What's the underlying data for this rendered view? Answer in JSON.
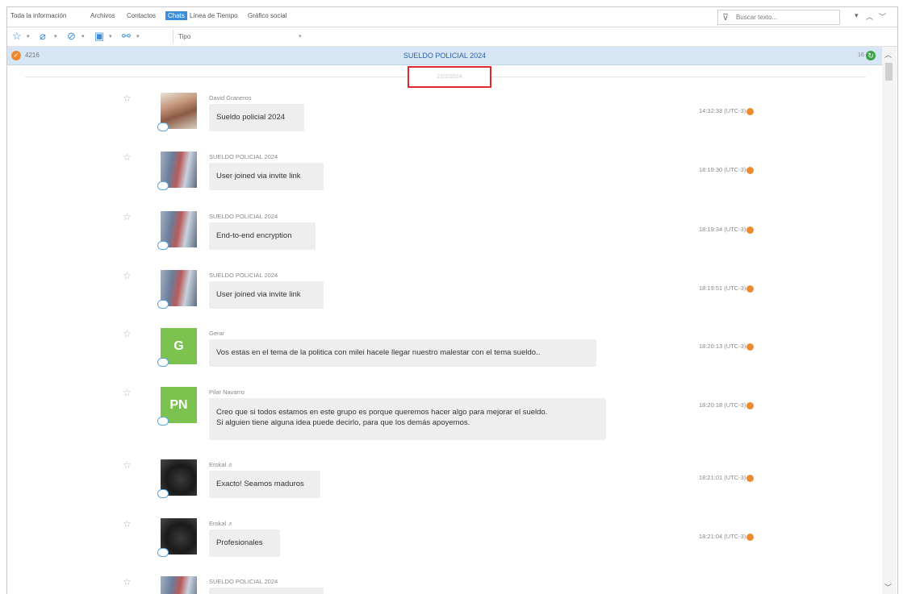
{
  "tabs": [
    {
      "label": "Toda la información",
      "active": false
    },
    {
      "label": "Archivos",
      "active": false
    },
    {
      "label": "Contactos",
      "active": false
    },
    {
      "label": "Chats",
      "active": true
    },
    {
      "label": "Línea de Tiempo",
      "active": false
    },
    {
      "label": "Gráfico social",
      "active": false
    }
  ],
  "search": {
    "placeholder": "Buscar texto..."
  },
  "toolbar": {
    "type_filter": "Tipo"
  },
  "chat_header": {
    "count": "4216",
    "title": "SUELDO POLICIAL 2024",
    "right_count": "16"
  },
  "date_separator": "22/2/2024",
  "messages": [
    {
      "sender": "David Graneros",
      "lines": [
        "Sueldo policial 2024"
      ],
      "time": "14:32:33 (UTC-3)",
      "avatar_type": "photo-a",
      "avatar_initials": ""
    },
    {
      "sender": "SUELDO POLICIAL 2024",
      "lines": [
        "User joined via invite link"
      ],
      "time": "18:19:30 (UTC-3)",
      "avatar_type": "photo-b",
      "avatar_initials": ""
    },
    {
      "sender": "SUELDO POLICIAL 2024",
      "lines": [
        "End-to-end encryption"
      ],
      "time": "18:19:34 (UTC-3)",
      "avatar_type": "photo-b",
      "avatar_initials": ""
    },
    {
      "sender": "SUELDO POLICIAL 2024",
      "lines": [
        "User joined via invite link"
      ],
      "time": "18:19:51 (UTC-3)",
      "avatar_type": "photo-b",
      "avatar_initials": ""
    },
    {
      "sender": "Gerar",
      "lines": [
        "Vos estas en el tema de la politica con milei hacele llegar nuestro malestar con el tema sueldo.."
      ],
      "time": "18:20:13 (UTC-3)",
      "avatar_type": "init",
      "avatar_initials": "G",
      "avatar_color": "#7cc24f"
    },
    {
      "sender": "Pilar Navarro",
      "lines": [
        "Creo que si todos estamos en este grupo es porque queremos hacer algo para mejorar el sueldo.",
        "Si alguien tiene alguna idea puede decirlo, para que los demás apoyemos."
      ],
      "time": "18:20:18 (UTC-3)",
      "avatar_type": "init",
      "avatar_initials": "PN",
      "avatar_color": "#7cc24f"
    },
    {
      "sender": "Erokal ♬",
      "lines": [
        "Exacto! Seamos maduros"
      ],
      "time": "18:21:01 (UTC-3)",
      "avatar_type": "photo-c",
      "avatar_initials": ""
    },
    {
      "sender": "Erokal ♬",
      "lines": [
        "Profesionales"
      ],
      "time": "18:21:04 (UTC-3)",
      "avatar_type": "photo-c",
      "avatar_initials": ""
    },
    {
      "sender": "SUELDO POLICIAL 2024",
      "lines": [
        ""
      ],
      "time": "",
      "avatar_type": "photo-b",
      "avatar_initials": ""
    }
  ],
  "colors": {
    "accent": "#3c8edc",
    "header_band": "#d6e6f5",
    "highlight_box": "#e0282e",
    "time_badge": "#ee8a2e",
    "initial_avatar": "#7cc24f"
  },
  "icons": [
    "star-icon",
    "tag-icon",
    "attachment-icon",
    "trash-icon",
    "share-icon",
    "funnel-icon",
    "chat-bubble-icon"
  ]
}
